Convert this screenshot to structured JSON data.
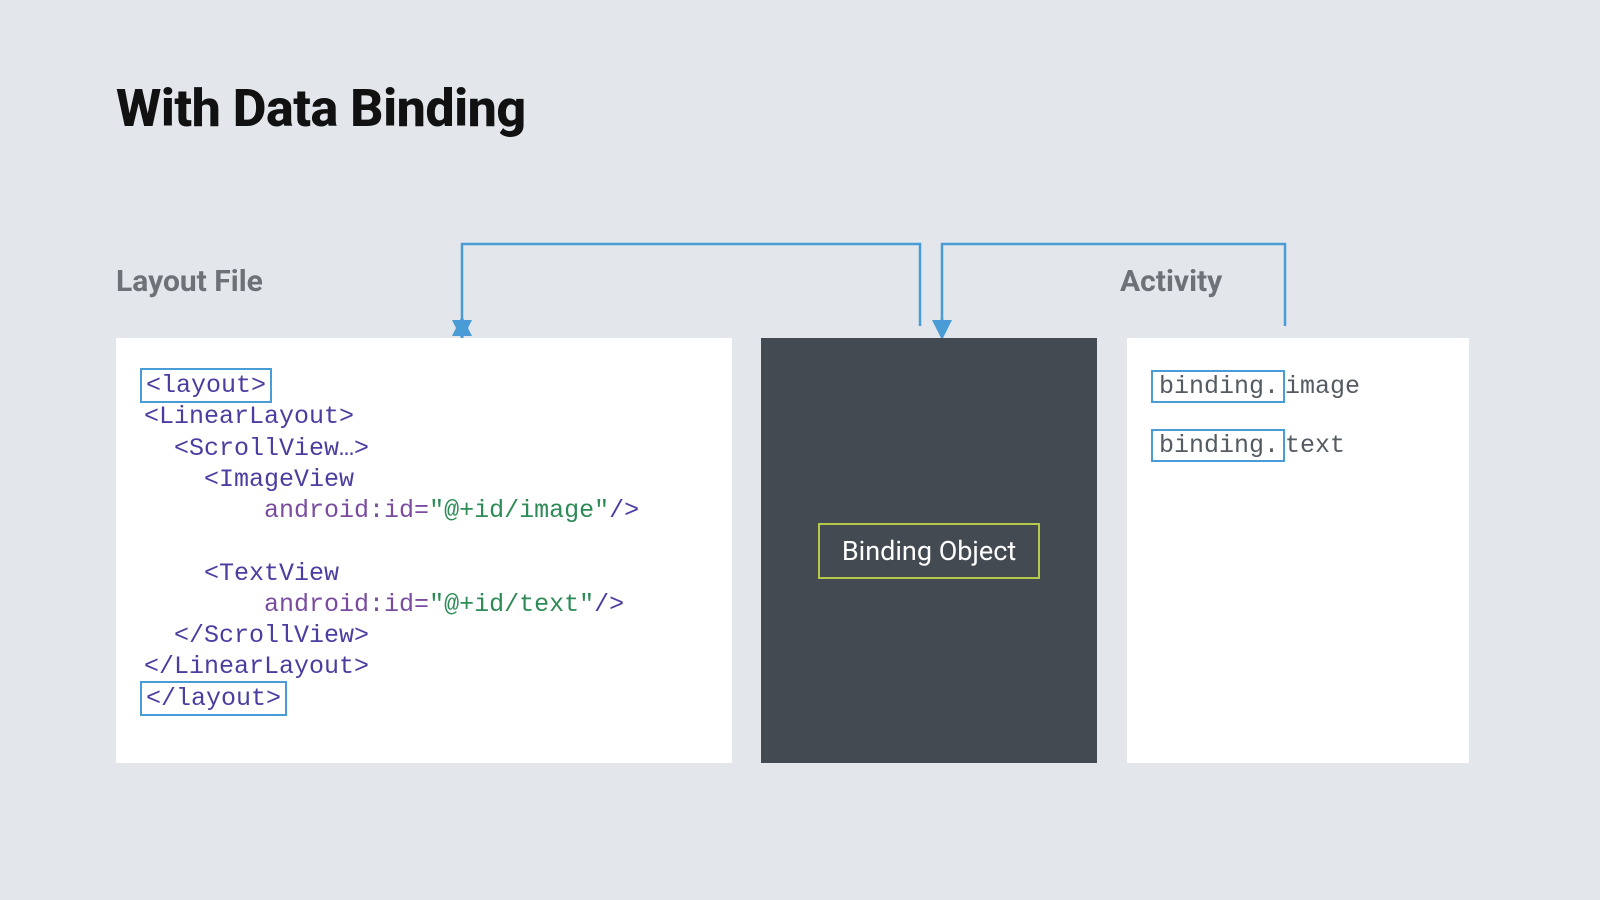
{
  "title": "With Data Binding",
  "labels": {
    "layout": "Layout File",
    "activity": "Activity"
  },
  "layout_code": {
    "layout_open": "<layout>",
    "linear_open": "<LinearLayout>",
    "scroll_open": "<ScrollView…>",
    "imageview_tag": "<ImageView",
    "imageview_attr": "android:id=",
    "imageview_val": "\"@+id/image\"",
    "imageview_close": "/>",
    "textview_tag": "<TextView",
    "textview_attr": "android:id=",
    "textview_val": "\"@+id/text\"",
    "textview_close": "/>",
    "scroll_close": "</ScrollView>",
    "linear_close": "</LinearLayout>",
    "layout_close": "</layout>"
  },
  "binding": {
    "label": "Binding Object"
  },
  "activity_code": {
    "prefix": "binding.",
    "item1": "image",
    "item2": "text"
  },
  "colors": {
    "bg": "#e3e6ea",
    "panel_dark": "#444a52",
    "arrow": "#4a9cd6",
    "highlight_green": "#b4c94a"
  }
}
